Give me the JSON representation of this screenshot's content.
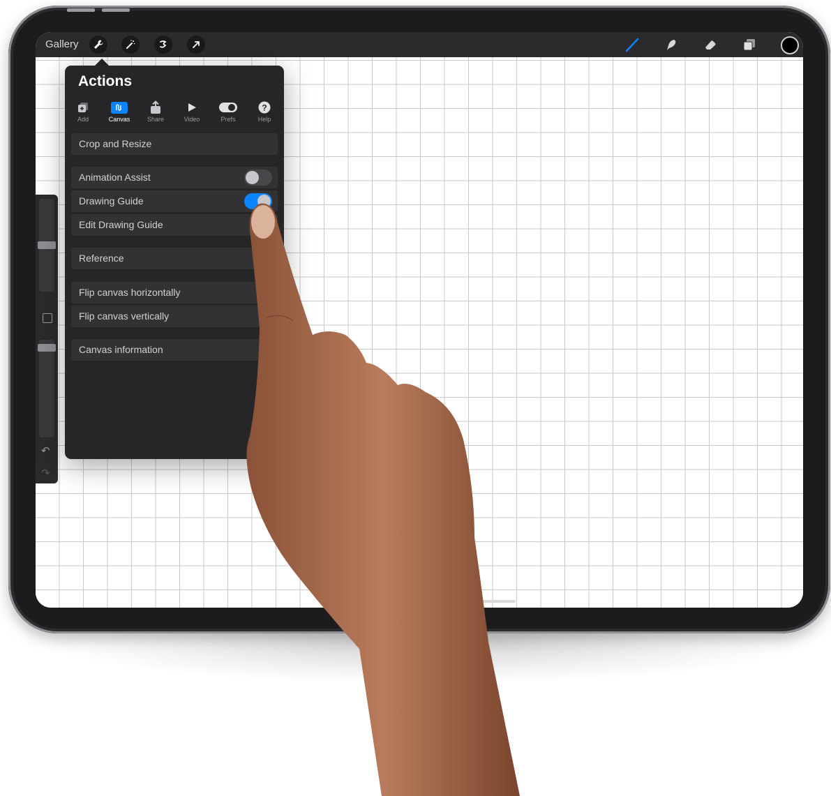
{
  "topbar": {
    "gallery_label": "Gallery",
    "left_icons": [
      "wrench-icon",
      "magic-wand-icon",
      "selection-icon",
      "transform-arrow-icon"
    ],
    "right_icons": [
      "brush-icon",
      "smudge-icon",
      "eraser-icon",
      "layers-icon",
      "color-swatch"
    ]
  },
  "colors": {
    "accent": "#0a84ff",
    "toolbar_bg": "#2b2b2d",
    "panel_bg": "#262628",
    "row_bg": "#323234",
    "current_color": "#000000"
  },
  "actions_panel": {
    "title": "Actions",
    "tabs": [
      {
        "label": "Add",
        "icon": "add-icon",
        "active": false
      },
      {
        "label": "Canvas",
        "icon": "canvas-icon",
        "active": true
      },
      {
        "label": "Share",
        "icon": "share-icon",
        "active": false
      },
      {
        "label": "Video",
        "icon": "play-icon",
        "active": false
      },
      {
        "label": "Prefs",
        "icon": "toggle-icon",
        "active": false
      },
      {
        "label": "Help",
        "icon": "help-icon",
        "active": false
      }
    ],
    "items": [
      {
        "label": "Crop and Resize"
      },
      {
        "label": "Animation Assist",
        "toggle": false
      },
      {
        "label": "Drawing Guide",
        "toggle": true
      },
      {
        "label": "Edit Drawing Guide"
      },
      {
        "label": "Reference"
      },
      {
        "label": "Flip canvas horizontally"
      },
      {
        "label": "Flip canvas vertically"
      },
      {
        "label": "Canvas information"
      }
    ]
  },
  "sidebar": {
    "brush_size": 0.5,
    "opacity": 0.95,
    "icons": [
      "modify-button",
      "undo-icon",
      "redo-icon"
    ]
  }
}
